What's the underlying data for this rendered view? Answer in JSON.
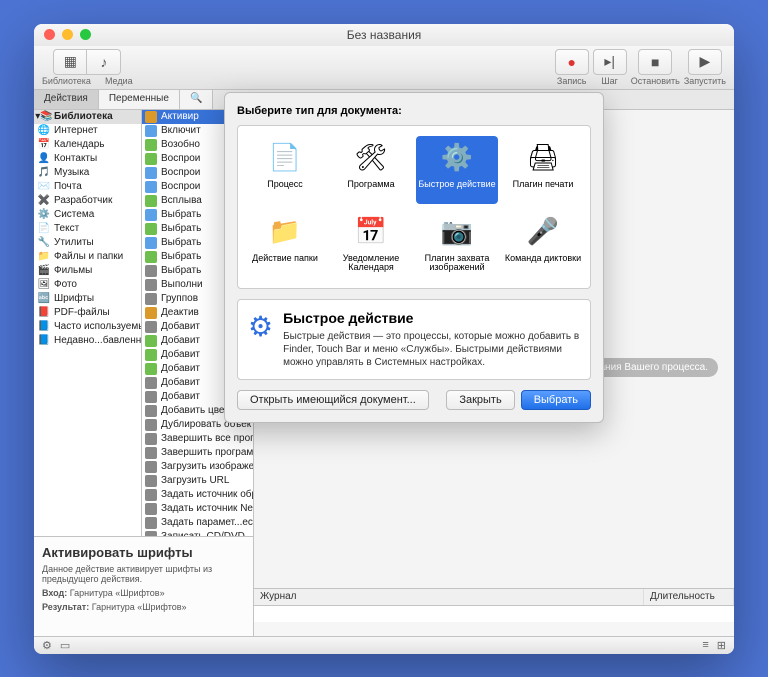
{
  "title": "Без названия",
  "toolbar": {
    "library": "Библиотека",
    "media": "Медиа",
    "record": "Запись",
    "step": "Шаг",
    "stop": "Остановить",
    "run": "Запустить"
  },
  "tabs": {
    "actions": "Действия",
    "variables": "Переменные"
  },
  "sidebar": {
    "root": "Библиотека",
    "items": [
      {
        "icon": "🌐",
        "label": "Интернет"
      },
      {
        "icon": "📅",
        "label": "Календарь"
      },
      {
        "icon": "👤",
        "label": "Контакты"
      },
      {
        "icon": "🎵",
        "label": "Музыка"
      },
      {
        "icon": "✉️",
        "label": "Почта"
      },
      {
        "icon": "✖️",
        "label": "Разработчик"
      },
      {
        "icon": "⚙️",
        "label": "Система"
      },
      {
        "icon": "📄",
        "label": "Текст"
      },
      {
        "icon": "🔧",
        "label": "Утилиты"
      },
      {
        "icon": "📁",
        "label": "Файлы и папки"
      },
      {
        "icon": "🎬",
        "label": "Фильмы"
      },
      {
        "icon": "🖼",
        "label": "Фото"
      },
      {
        "icon": "🔤",
        "label": "Шрифты"
      },
      {
        "icon": "📕",
        "label": "PDF-файлы"
      }
    ],
    "smart": [
      {
        "icon": "📘",
        "label": "Часто используемые"
      },
      {
        "icon": "📘",
        "label": "Недавно...бавленные"
      }
    ]
  },
  "actionsCol": [
    {
      "c": "#d99a2b",
      "t": "Активир",
      "sel": true
    },
    {
      "c": "#5aa1e8",
      "t": "Включит"
    },
    {
      "c": "#6fbf4f",
      "t": "Возобно"
    },
    {
      "c": "#6fbf4f",
      "t": "Воспрои"
    },
    {
      "c": "#5aa1e8",
      "t": "Воспрои"
    },
    {
      "c": "#5aa1e8",
      "t": "Воспрои"
    },
    {
      "c": "#6fbf4f",
      "t": "Всплыва"
    },
    {
      "c": "#5aa1e8",
      "t": "Выбрать"
    },
    {
      "c": "#6fbf4f",
      "t": "Выбрать"
    },
    {
      "c": "#5aa1e8",
      "t": "Выбрать"
    },
    {
      "c": "#6fbf4f",
      "t": "Выбрать"
    },
    {
      "c": "#888",
      "t": "Выбрать"
    },
    {
      "c": "#888",
      "t": "Выполни"
    },
    {
      "c": "#888",
      "t": "Группов"
    },
    {
      "c": "#d99a2b",
      "t": "Деактив"
    },
    {
      "c": "#888",
      "t": "Добавит"
    },
    {
      "c": "#6fbf4f",
      "t": "Добавит"
    },
    {
      "c": "#6fbf4f",
      "t": "Добавит"
    },
    {
      "c": "#6fbf4f",
      "t": "Добавит"
    },
    {
      "c": "#888",
      "t": "Добавит"
    },
    {
      "c": "#888",
      "t": "Добавит"
    }
  ],
  "actionsLong": [
    "Добавить цветовой профиль",
    "Дублировать объекты Finder",
    "Завершить все программы",
    "Завершить программу",
    "Загрузить изображения",
    "Загрузить URL",
    "Задать источник образа",
    "Задать источник NetRestore",
    "Задать парамет...ескольких томов",
    "Записать CD/DVD"
  ],
  "hint": "ания Вашего процесса.",
  "log": {
    "journal": "Журнал",
    "duration": "Длительность"
  },
  "info": {
    "title": "Активировать шрифты",
    "desc": "Данное действие активирует шрифты из предыдущего действия.",
    "in_label": "Вход:",
    "in_val": "Гарнитура «Шрифтов»",
    "out_label": "Результат:",
    "out_val": "Гарнитура «Шрифтов»"
  },
  "modal": {
    "heading": "Выберите тип для документа:",
    "types": [
      {
        "icon": "📄",
        "label": "Процесс"
      },
      {
        "icon": "🛠",
        "label": "Программа"
      },
      {
        "icon": "⚙️",
        "label": "Быстрое действие",
        "sel": true
      },
      {
        "icon": "🖨",
        "label": "Плагин печати"
      },
      {
        "icon": "📁",
        "label": "Действие папки"
      },
      {
        "icon": "📅",
        "label": "Уведомление Календаря"
      },
      {
        "icon": "📷",
        "label": "Плагин захвата изображений"
      },
      {
        "icon": "🎤",
        "label": "Команда диктовки"
      }
    ],
    "desc_title": "Быстрое действие",
    "desc_body": "Быстрые действия — это процессы, которые можно добавить в Finder, Touch Bar и меню «Службы». Быстрыми действиями можно управлять в Системных настройках.",
    "open": "Открыть имеющийся документ...",
    "close": "Закрыть",
    "choose": "Выбрать"
  }
}
